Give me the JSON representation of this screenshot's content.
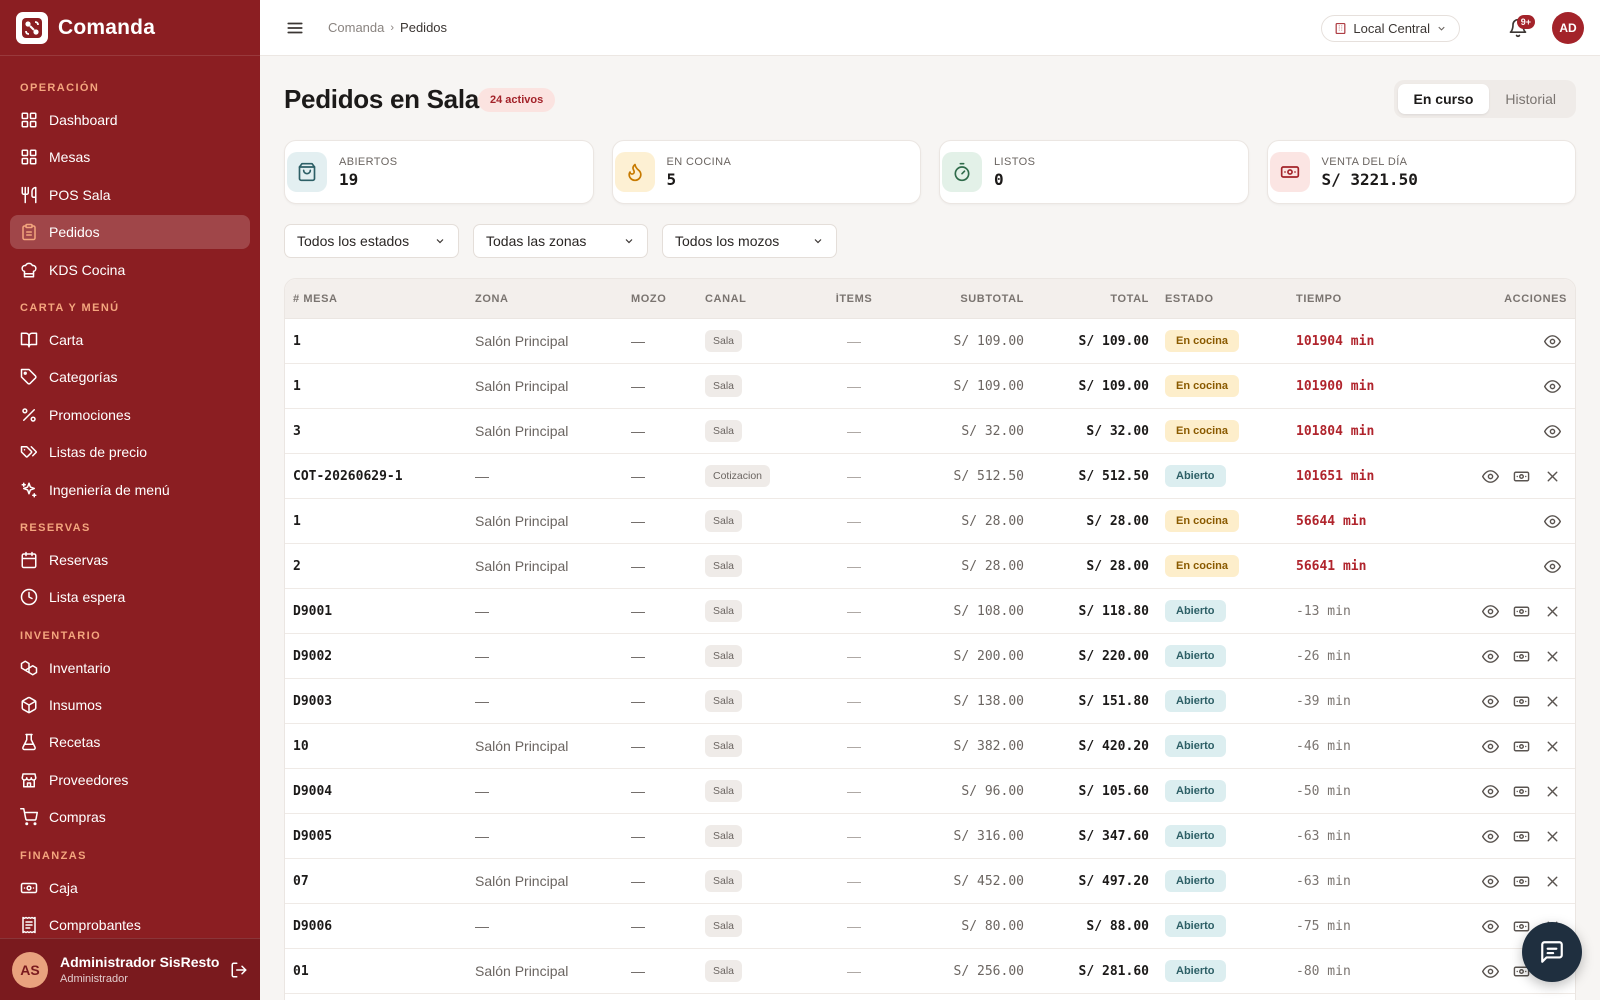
{
  "brand": {
    "name": "Comanda"
  },
  "sidebar": {
    "sections": [
      {
        "title": "OPERACIÓN",
        "items": [
          {
            "label": "Dashboard",
            "icon": "dashboard-icon"
          },
          {
            "label": "Mesas",
            "icon": "tables-icon"
          },
          {
            "label": "POS Sala",
            "icon": "utensils-icon"
          },
          {
            "label": "Pedidos",
            "icon": "clipboard-icon",
            "active": true
          },
          {
            "label": "KDS Cocina",
            "icon": "chef-hat-icon"
          }
        ]
      },
      {
        "title": "CARTA Y MENÚ",
        "items": [
          {
            "label": "Carta",
            "icon": "book-icon"
          },
          {
            "label": "Categorías",
            "icon": "tag-icon"
          },
          {
            "label": "Promociones",
            "icon": "percent-icon"
          },
          {
            "label": "Listas de precio",
            "icon": "tags-icon"
          },
          {
            "label": "Ingeniería de menú",
            "icon": "sparkles-icon"
          }
        ]
      },
      {
        "title": "RESERVAS",
        "items": [
          {
            "label": "Reservas",
            "icon": "calendar-icon"
          },
          {
            "label": "Lista espera",
            "icon": "clock-icon"
          }
        ]
      },
      {
        "title": "INVENTARIO",
        "items": [
          {
            "label": "Inventario",
            "icon": "boxes-icon"
          },
          {
            "label": "Insumos",
            "icon": "package-icon"
          },
          {
            "label": "Recetas",
            "icon": "flask-icon"
          },
          {
            "label": "Proveedores",
            "icon": "store-icon"
          },
          {
            "label": "Compras",
            "icon": "cart-icon"
          }
        ]
      },
      {
        "title": "FINANZAS",
        "items": [
          {
            "label": "Caja",
            "icon": "cash-icon"
          },
          {
            "label": "Comprobantes",
            "icon": "receipt-icon"
          }
        ]
      }
    ]
  },
  "user": {
    "initials": "AS",
    "name": "Administrador SisResto",
    "role": "Administrador"
  },
  "topbar": {
    "breadcrumb": [
      "Comanda",
      "Pedidos"
    ],
    "location": "Local Central",
    "notifications": "9+",
    "avatar": "AD"
  },
  "page": {
    "title": "Pedidos en Sala",
    "badge": "24 activos",
    "tabs": [
      "En curso",
      "Historial"
    ],
    "active_tab": "En curso"
  },
  "stats": [
    {
      "label": "ABIERTOS",
      "value": "19",
      "icon": "bag-icon",
      "color": "#2d5f66",
      "bg": "#e3eff1"
    },
    {
      "label": "EN COCINA",
      "value": "5",
      "icon": "flame-icon",
      "color": "#c77a00",
      "bg": "#fdf0d3"
    },
    {
      "label": "LISTOS",
      "value": "0",
      "icon": "timer-icon",
      "color": "#2f6b4a",
      "bg": "#e3f1e8"
    },
    {
      "label": "VENTA DEL DÍA",
      "value": "S/ 3221.50",
      "icon": "banknote-icon",
      "color": "#a3232a",
      "bg": "#fbe5e3"
    }
  ],
  "filters": [
    "Todos los estados",
    "Todas las zonas",
    "Todos los mozos"
  ],
  "table": {
    "columns": [
      "# MESA",
      "ZONA",
      "MOZO",
      "CANAL",
      "ÍTEMS",
      "SUBTOTAL",
      "TOTAL",
      "ESTADO",
      "TIEMPO",
      "ACCIONES"
    ],
    "rows": [
      {
        "mesa": "1",
        "zona": "Salón Principal",
        "mozo": "—",
        "canal": "Sala",
        "items": "—",
        "subtotal": "S/ 109.00",
        "total": "S/ 109.00",
        "estado": "En cocina",
        "tiempo": "101904 min",
        "late": true,
        "actions": [
          "view"
        ]
      },
      {
        "mesa": "1",
        "zona": "Salón Principal",
        "mozo": "—",
        "canal": "Sala",
        "items": "—",
        "subtotal": "S/ 109.00",
        "total": "S/ 109.00",
        "estado": "En cocina",
        "tiempo": "101900 min",
        "late": true,
        "actions": [
          "view"
        ]
      },
      {
        "mesa": "3",
        "zona": "Salón Principal",
        "mozo": "—",
        "canal": "Sala",
        "items": "—",
        "subtotal": "S/ 32.00",
        "total": "S/ 32.00",
        "estado": "En cocina",
        "tiempo": "101804 min",
        "late": true,
        "actions": [
          "view"
        ]
      },
      {
        "mesa": "COT-20260629-1",
        "zona": "—",
        "mozo": "—",
        "canal": "Cotizacion",
        "items": "—",
        "subtotal": "S/ 512.50",
        "total": "S/ 512.50",
        "estado": "Abierto",
        "tiempo": "101651 min",
        "late": true,
        "actions": [
          "view",
          "pay",
          "cancel"
        ]
      },
      {
        "mesa": "1",
        "zona": "Salón Principal",
        "mozo": "—",
        "canal": "Sala",
        "items": "—",
        "subtotal": "S/ 28.00",
        "total": "S/ 28.00",
        "estado": "En cocina",
        "tiempo": "56644 min",
        "late": true,
        "actions": [
          "view"
        ]
      },
      {
        "mesa": "2",
        "zona": "Salón Principal",
        "mozo": "—",
        "canal": "Sala",
        "items": "—",
        "subtotal": "S/ 28.00",
        "total": "S/ 28.00",
        "estado": "En cocina",
        "tiempo": "56641 min",
        "late": true,
        "actions": [
          "view"
        ]
      },
      {
        "mesa": "D9001",
        "zona": "—",
        "mozo": "—",
        "canal": "Sala",
        "items": "—",
        "subtotal": "S/ 108.00",
        "total": "S/ 118.80",
        "estado": "Abierto",
        "tiempo": "-13 min",
        "late": false,
        "actions": [
          "view",
          "pay",
          "cancel"
        ]
      },
      {
        "mesa": "D9002",
        "zona": "—",
        "mozo": "—",
        "canal": "Sala",
        "items": "—",
        "subtotal": "S/ 200.00",
        "total": "S/ 220.00",
        "estado": "Abierto",
        "tiempo": "-26 min",
        "late": false,
        "actions": [
          "view",
          "pay",
          "cancel"
        ]
      },
      {
        "mesa": "D9003",
        "zona": "—",
        "mozo": "—",
        "canal": "Sala",
        "items": "—",
        "subtotal": "S/ 138.00",
        "total": "S/ 151.80",
        "estado": "Abierto",
        "tiempo": "-39 min",
        "late": false,
        "actions": [
          "view",
          "pay",
          "cancel"
        ]
      },
      {
        "mesa": "10",
        "zona": "Salón Principal",
        "mozo": "—",
        "canal": "Sala",
        "items": "—",
        "subtotal": "S/ 382.00",
        "total": "S/ 420.20",
        "estado": "Abierto",
        "tiempo": "-46 min",
        "late": false,
        "actions": [
          "view",
          "pay",
          "cancel"
        ]
      },
      {
        "mesa": "D9004",
        "zona": "—",
        "mozo": "—",
        "canal": "Sala",
        "items": "—",
        "subtotal": "S/ 96.00",
        "total": "S/ 105.60",
        "estado": "Abierto",
        "tiempo": "-50 min",
        "late": false,
        "actions": [
          "view",
          "pay",
          "cancel"
        ]
      },
      {
        "mesa": "D9005",
        "zona": "—",
        "mozo": "—",
        "canal": "Sala",
        "items": "—",
        "subtotal": "S/ 316.00",
        "total": "S/ 347.60",
        "estado": "Abierto",
        "tiempo": "-63 min",
        "late": false,
        "actions": [
          "view",
          "pay",
          "cancel"
        ]
      },
      {
        "mesa": "07",
        "zona": "Salón Principal",
        "mozo": "—",
        "canal": "Sala",
        "items": "—",
        "subtotal": "S/ 452.00",
        "total": "S/ 497.20",
        "estado": "Abierto",
        "tiempo": "-63 min",
        "late": false,
        "actions": [
          "view",
          "pay",
          "cancel"
        ]
      },
      {
        "mesa": "D9006",
        "zona": "—",
        "mozo": "—",
        "canal": "Sala",
        "items": "—",
        "subtotal": "S/ 80.00",
        "total": "S/ 88.00",
        "estado": "Abierto",
        "tiempo": "-75 min",
        "late": false,
        "actions": [
          "view",
          "pay",
          "cancel"
        ]
      },
      {
        "mesa": "01",
        "zona": "Salón Principal",
        "mozo": "—",
        "canal": "Sala",
        "items": "—",
        "subtotal": "S/ 256.00",
        "total": "S/ 281.60",
        "estado": "Abierto",
        "tiempo": "-80 min",
        "late": false,
        "actions": [
          "view",
          "pay",
          "cancel"
        ]
      }
    ]
  },
  "colors": {
    "sidebar": "#8b1e22",
    "accent": "#a3232a",
    "section": "#f4a67e"
  }
}
